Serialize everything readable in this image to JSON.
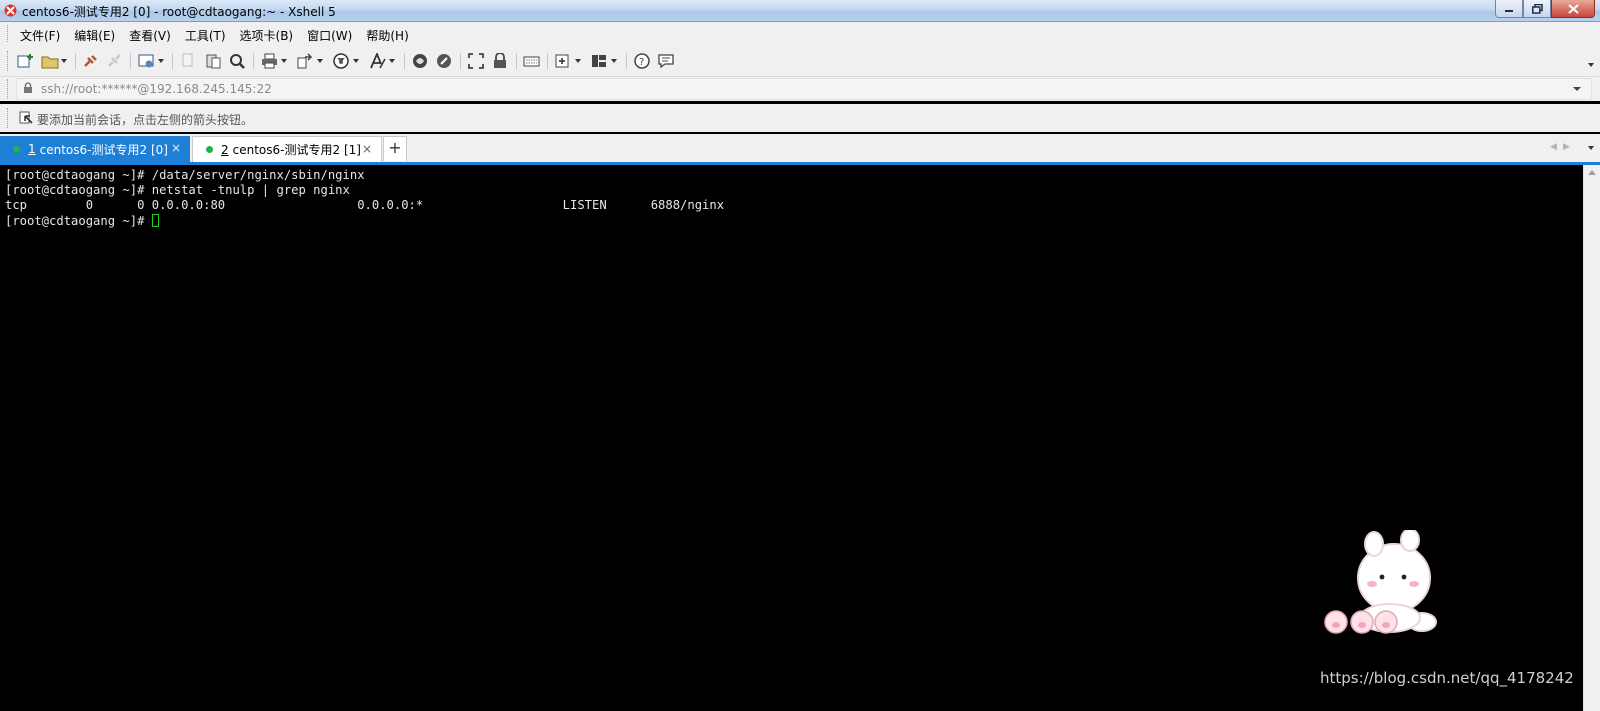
{
  "window": {
    "title": "centos6-测试专用2 [0] - root@cdtaogang:~ - Xshell 5"
  },
  "menu": {
    "items": [
      {
        "label": "文件(F)"
      },
      {
        "label": "编辑(E)"
      },
      {
        "label": "查看(V)"
      },
      {
        "label": "工具(T)"
      },
      {
        "label": "选项卡(B)"
      },
      {
        "label": "窗口(W)"
      },
      {
        "label": "帮助(H)"
      }
    ]
  },
  "toolbar": {
    "icons": [
      "new-session-icon",
      "open-folder-icon",
      "connect-icon",
      "disconnect-icon",
      "session-settings-icon",
      "copy-icon",
      "paste-icon",
      "find-icon",
      "print-icon",
      "transfer-icon",
      "globe-icon",
      "font-icon",
      "xftp-icon",
      "script-icon",
      "fullscreen-icon",
      "lock-icon",
      "keyboard-icon",
      "compose-icon",
      "layout-icon",
      "help-icon",
      "chat-icon"
    ]
  },
  "address": {
    "value": "ssh://root:******@192.168.245.145:22"
  },
  "hint": {
    "text": "要添加当前会话，点击左侧的箭头按钮。"
  },
  "tabs": [
    {
      "number": "1",
      "label": "centos6-测试专用2 [0]",
      "status_color": "#21b24a",
      "active": true
    },
    {
      "number": "2",
      "label": "centos6-测试专用2 [1]",
      "status_color": "#21b24a",
      "active": false
    }
  ],
  "tab_add_label": "+",
  "tab_close_label": "×",
  "terminal": {
    "lines": [
      "[root@cdtaogang ~]# /data/server/nginx/sbin/nginx",
      "[root@cdtaogang ~]# netstat -tnulp | grep nginx",
      "tcp        0      0 0.0.0.0:80                  0.0.0.0:*                   LISTEN      6888/nginx"
    ],
    "prompt": "[root@cdtaogang ~]# ",
    "cursor_color": "#1fd21f"
  },
  "watermark": {
    "text": "https://blog.csdn.net/qq_4178242"
  },
  "colors": {
    "accent": "#1e7fd6",
    "terminal_bg": "#000000",
    "terminal_fg": "#e6e6e6"
  }
}
